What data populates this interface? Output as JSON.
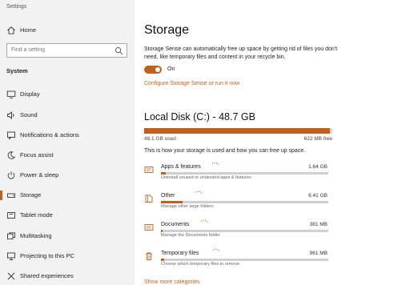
{
  "window": {
    "title": "Settings"
  },
  "sidebar": {
    "home_label": "Home",
    "search_placeholder": "Find a setting",
    "section_label": "System",
    "items": [
      {
        "label": "Display",
        "icon": "display-icon"
      },
      {
        "label": "Sound",
        "icon": "speaker-icon"
      },
      {
        "label": "Notifications & actions",
        "icon": "notification-icon"
      },
      {
        "label": "Focus assist",
        "icon": "moon-icon"
      },
      {
        "label": "Power & sleep",
        "icon": "power-icon"
      },
      {
        "label": "Storage",
        "icon": "storage-icon",
        "active": true
      },
      {
        "label": "Tablet mode",
        "icon": "tablet-icon"
      },
      {
        "label": "Multitasking",
        "icon": "multitasking-icon"
      },
      {
        "label": "Projecting to this PC",
        "icon": "projector-icon"
      },
      {
        "label": "Shared experiences",
        "icon": "shared-icon"
      }
    ]
  },
  "main": {
    "title": "Storage",
    "description": "Storage Sense can automatically free up space by getting rid of files you don't need, like temporary files and content in your recycle bin.",
    "toggle_state": "On",
    "configure_link": "Configure Storage Sense or run it now",
    "disk": {
      "title": "Local Disk (C:) - 48.7 GB",
      "used_label": "48.1 GB used",
      "free_label": "622 MB free",
      "used_fraction": 0.988
    },
    "usage_description": "This is how your storage is used and how you can free up space.",
    "categories": [
      {
        "name": "Apps & features",
        "size": "1.64 GB",
        "sub": "Uninstall unused or undesired apps & features",
        "fraction": 0.03,
        "icon": "apps-icon"
      },
      {
        "name": "Other",
        "size": "6.41 GB",
        "sub": "Manage other large folders",
        "fraction": 0.13,
        "icon": "folder-icon"
      },
      {
        "name": "Documents",
        "size": "381 MB",
        "sub": "Manage the Documents folder",
        "fraction": 0.01,
        "icon": "documents-icon"
      },
      {
        "name": "Temporary files",
        "size": "961 MB",
        "sub": "Choose which temporary files to remove",
        "fraction": 0.02,
        "icon": "trash-icon"
      }
    ],
    "show_more_link": "Show more categories"
  },
  "colors": {
    "accent": "#c0601a",
    "sidebar_bg": "#f2f2f2",
    "track": "#cfcfcf"
  }
}
